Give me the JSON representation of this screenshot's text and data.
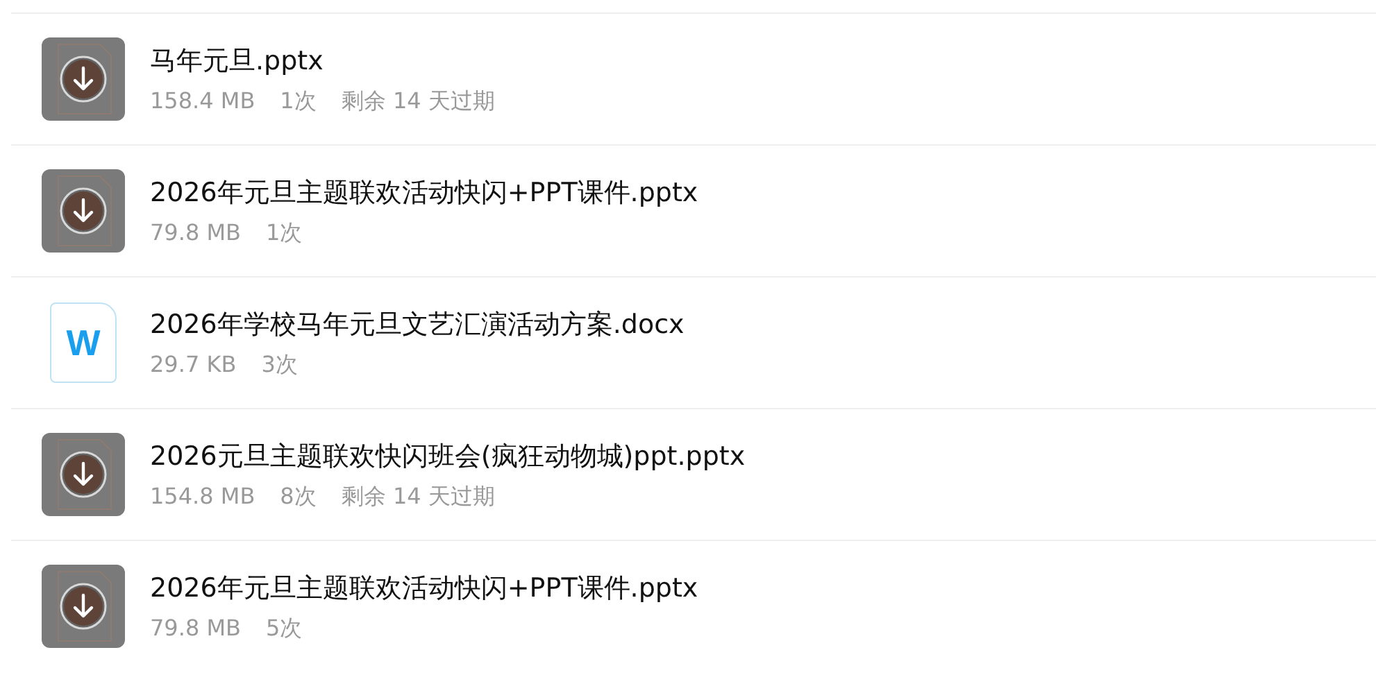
{
  "files": [
    {
      "kind": "pptx",
      "downloading": true,
      "name": "马年元旦.pptx",
      "size": "158.4 MB",
      "count": "1次",
      "expiry": "剩余 14 天过期"
    },
    {
      "kind": "pptx",
      "downloading": true,
      "name": "2026年元旦主题联欢活动快闪+PPT课件.pptx",
      "size": "79.8 MB",
      "count": "1次"
    },
    {
      "kind": "docx",
      "downloading": false,
      "icon_letter": "W",
      "name": "2026年学校马年元旦文艺汇演活动方案.docx",
      "size": "29.7 KB",
      "count": "3次"
    },
    {
      "kind": "pptx",
      "downloading": true,
      "name": "2026元旦主题联欢快闪班会(疯狂动物城)ppt.pptx",
      "size": "154.8 MB",
      "count": "8次",
      "expiry": "剩余 14 天过期"
    },
    {
      "kind": "pptx",
      "downloading": true,
      "name": "2026年元旦主题联欢活动快闪+PPT课件.pptx",
      "size": "79.8 MB",
      "count": "5次"
    }
  ]
}
